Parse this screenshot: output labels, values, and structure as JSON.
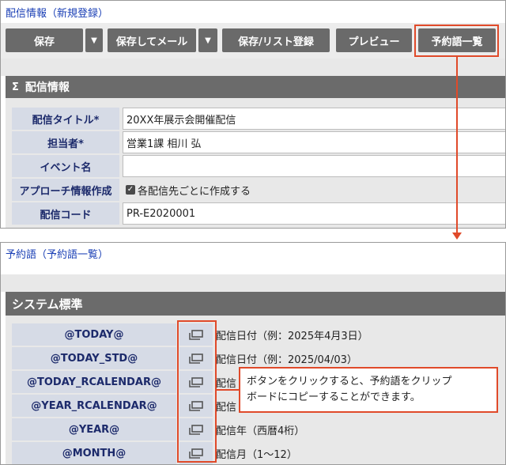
{
  "top": {
    "breadcrumb": "配信情報（新規登録）",
    "toolbar": {
      "save": "保存",
      "save_dropdown": "▼",
      "save_mail": "保存してメール",
      "save_mail_dropdown": "▼",
      "save_list": "保存/リスト登録",
      "preview": "プレビュー",
      "reserved_words": "予約語一覧"
    },
    "section": {
      "toggle": "Σ",
      "title": "配信情報"
    },
    "form": [
      {
        "label": "配信タイトル*",
        "value": "20XX年展示会開催配信"
      },
      {
        "label": "担当者*",
        "value": "営業1課 相川 弘"
      },
      {
        "label": "イベント名",
        "value": ""
      },
      {
        "label": "アプローチ情報作成",
        "check": "✓",
        "value": "各配信先ごとに作成する"
      },
      {
        "label": "配信コード",
        "value": "PR-E2020001"
      }
    ]
  },
  "bottom": {
    "breadcrumb": "予約語（予約語一覧）",
    "section": {
      "title": "システム標準"
    },
    "rows": [
      {
        "word": "@TODAY@",
        "desc": "配信日付（例：2025年4月3日）"
      },
      {
        "word": "@TODAY_STD@",
        "desc": "配信日付（例：2025/04/03）"
      },
      {
        "word": "@TODAY_RCALENDAR@",
        "desc": "配信"
      },
      {
        "word": "@YEAR_RCALENDAR@",
        "desc": "配信"
      },
      {
        "word": "@YEAR@",
        "desc": "配信年（西暦4桁）"
      },
      {
        "word": "@MONTH@",
        "desc": "配信月（1～12）"
      }
    ]
  },
  "callout": {
    "line1": "ボタンをクリックすると、予約語をクリップ",
    "line2": "ボードにコピーすることができます。"
  },
  "colors": {
    "accent": "#e04a2a",
    "link": "#1a3fb5",
    "toolbar_button": "#6a6a6a",
    "label_bg": "#d6dbe6"
  }
}
